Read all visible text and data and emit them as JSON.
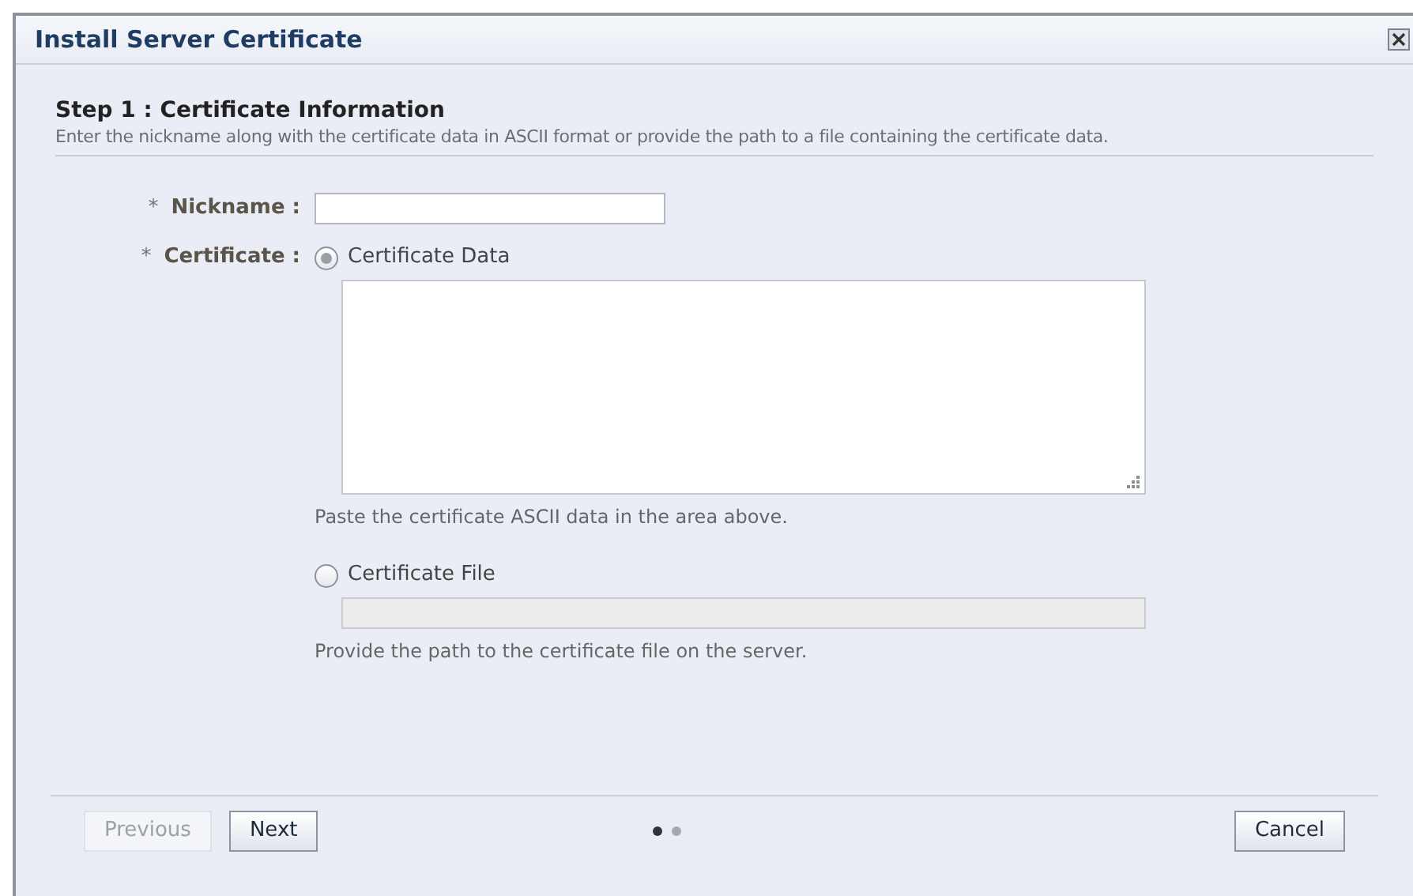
{
  "dialog": {
    "title": "Install Server Certificate"
  },
  "step": {
    "heading": "Step 1 : Certificate Information",
    "description": "Enter the nickname along with the certificate data in ASCII format or provide the path to a file containing the certificate data."
  },
  "nickname": {
    "required_mark": "*",
    "label": "Nickname :"
  },
  "certificate": {
    "required_mark": "*",
    "label": "Certificate :",
    "options": [
      {
        "label": "Certificate Data",
        "selected": true,
        "kind": "textarea",
        "disabled": false,
        "help": "Paste the certificate ASCII data in the area above."
      },
      {
        "label": "Certificate File",
        "selected": false,
        "kind": "file",
        "disabled": true,
        "help": "Provide the path to the certificate file on the server."
      }
    ]
  },
  "buttons": [
    {
      "label": "Previous",
      "disabled": true
    },
    {
      "label": "Next",
      "disabled": false
    }
  ],
  "pager": [
    {
      "selected": true
    },
    {
      "selected": false
    }
  ],
  "cancel": {
    "label": "Cancel"
  }
}
